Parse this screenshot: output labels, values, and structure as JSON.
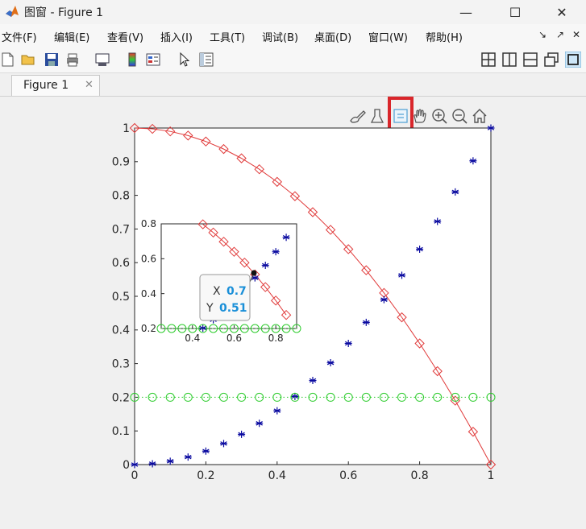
{
  "window": {
    "title": "图窗 - Figure 1",
    "minimize": "—",
    "maximize": "☐",
    "close": "✕"
  },
  "menu": [
    "文件(F)",
    "编辑(E)",
    "查看(V)",
    "插入(I)",
    "工具(T)",
    "调试(B)",
    "桌面(D)",
    "窗口(W)",
    "帮助(H)"
  ],
  "tab": {
    "label": "Figure 1",
    "close": "✕"
  },
  "datatip": {
    "x_label": "X",
    "x_value": "0.7",
    "y_label": "Y",
    "y_value": "0.51"
  },
  "colors": {
    "red": "#e03a3a",
    "blue": "#0a0aa0",
    "green": "#2ecc2e",
    "highlight": "#d9262b",
    "tip_blue": "#1a8fd8"
  },
  "chart_data": [
    {
      "type": "line",
      "xlim": [
        0,
        1
      ],
      "ylim": [
        0,
        1
      ],
      "xticks": [
        "0",
        "0.2",
        "0.4",
        "0.6",
        "0.8",
        "1"
      ],
      "yticks": [
        "0",
        "0.1",
        "0.2",
        "0.3",
        "0.4",
        "0.5",
        "0.6",
        "0.7",
        "0.8",
        "0.9",
        "1"
      ],
      "x": [
        0,
        0.05,
        0.1,
        0.15,
        0.2,
        0.25,
        0.3,
        0.35,
        0.4,
        0.45,
        0.5,
        0.55,
        0.6,
        0.65,
        0.7,
        0.75,
        0.8,
        0.85,
        0.9,
        0.95,
        1
      ],
      "series": [
        {
          "marker": "diamond",
          "style": "solid",
          "color": "#e03a3a",
          "values": [
            1,
            0.9975,
            0.99,
            0.9775,
            0.96,
            0.9375,
            0.91,
            0.8775,
            0.84,
            0.7975,
            0.75,
            0.6975,
            0.64,
            0.5775,
            0.51,
            0.4375,
            0.36,
            0.2775,
            0.19,
            0.0975,
            0
          ]
        },
        {
          "marker": "asterisk",
          "style": "none",
          "color": "#0a0aa0",
          "values": [
            0,
            0.0025,
            0.01,
            0.0225,
            0.04,
            0.0625,
            0.09,
            0.1225,
            0.16,
            0.2025,
            0.25,
            0.3025,
            0.36,
            0.4225,
            0.49,
            0.5625,
            0.64,
            0.7225,
            0.81,
            0.9025,
            1
          ]
        },
        {
          "marker": "circle",
          "style": "dotted",
          "color": "#2ecc2e",
          "values": [
            0.2,
            0.2,
            0.2,
            0.2,
            0.2,
            0.2,
            0.2,
            0.2,
            0.2,
            0.2,
            0.2,
            0.2,
            0.2,
            0.2,
            0.2,
            0.2,
            0.2,
            0.2,
            0.2,
            0.2,
            0.2
          ]
        }
      ],
      "grid": false
    },
    {
      "type": "line",
      "xlim": [
        0.25,
        0.9
      ],
      "ylim": [
        0.2,
        0.8
      ],
      "xticks": [
        "0.4",
        "0.6",
        "0.8"
      ],
      "yticks": [
        "0.2",
        "0.4",
        "0.6",
        "0.8"
      ],
      "grid": false
    }
  ]
}
